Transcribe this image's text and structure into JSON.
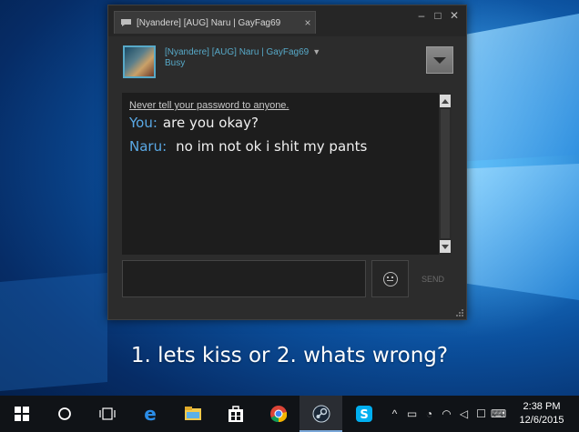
{
  "chat_window": {
    "tab_title": "[Nyandere] [AUG] Naru | GayFag69",
    "tab_close": "×",
    "minimize": "–",
    "maximize": "□",
    "close": "✕",
    "friend_name": "[Nyandere] [AUG] Naru | GayFag69",
    "friend_status": "Busy",
    "warning": "Never tell your password to anyone.",
    "messages": [
      {
        "sender": "You:",
        "text": "are you okay?"
      },
      {
        "sender": "Naru:",
        "text": "no im not ok i shit my pants"
      }
    ],
    "send_label": "SEND",
    "accent_color": "#57a9c8"
  },
  "caption": "1. lets kiss or 2. whats wrong?",
  "taskbar": {
    "icons": [
      "windows-start-icon",
      "search-circle-icon",
      "task-view-icon",
      "edge-icon",
      "file-explorer-icon",
      "store-icon",
      "chrome-icon",
      "steam-icon",
      "skype-icon"
    ],
    "time": "2:38 PM",
    "date": "12/6/2015"
  }
}
